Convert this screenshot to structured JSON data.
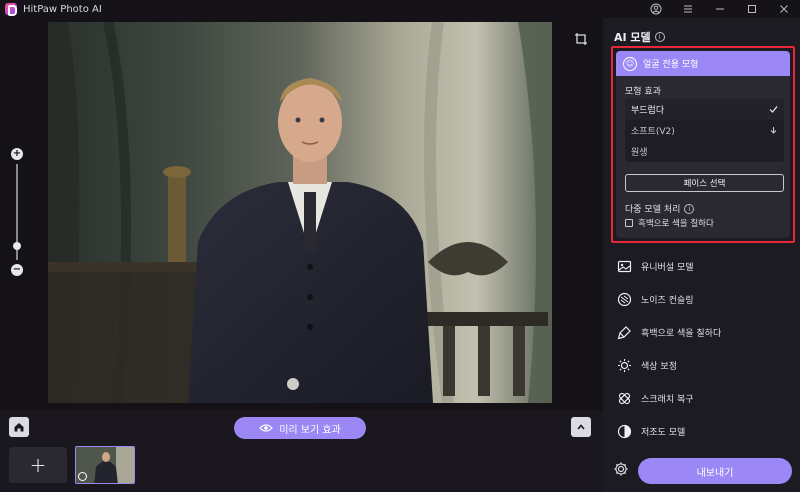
{
  "app": {
    "title": "HitPaw Photo AI"
  },
  "titlebar": {
    "icons": [
      "account-icon",
      "menu-icon",
      "minimize-icon",
      "maximize-icon",
      "close-icon"
    ]
  },
  "canvas": {
    "zoom_level": 0.15
  },
  "bottom": {
    "preview_label": "미리 보기 효과",
    "add_label": "+"
  },
  "panel": {
    "title": "AI 모델",
    "face_model": {
      "label": "얼굴 전용 모형",
      "effect_label": "모형 효과",
      "options": [
        {
          "label": "부드럽다",
          "state": "selected"
        },
        {
          "label": "소프트(V2)",
          "state": "download"
        },
        {
          "label": "원생",
          "state": ""
        }
      ],
      "face_select_label": "페이스 선택",
      "multi_label": "다중 모델 처리",
      "colorize_checkbox_label": "흑백으로 색을 칠하다"
    },
    "models": [
      {
        "label": "유니버설 모델",
        "icon": "image-icon"
      },
      {
        "label": "노이즈 컨슬링",
        "icon": "denoise-icon"
      },
      {
        "label": "흑백으로 색을 칠하다",
        "icon": "brush-icon"
      },
      {
        "label": "색상 보정",
        "icon": "sun-icon"
      },
      {
        "label": "스크래치 복구",
        "icon": "bandage-icon"
      },
      {
        "label": "저조도 모델",
        "icon": "contrast-icon"
      }
    ],
    "export_label": "내보내기"
  },
  "colors": {
    "accent": "#9b87f5",
    "highlight_border": "#e8283a",
    "panel_bg": "#1d1b22"
  }
}
